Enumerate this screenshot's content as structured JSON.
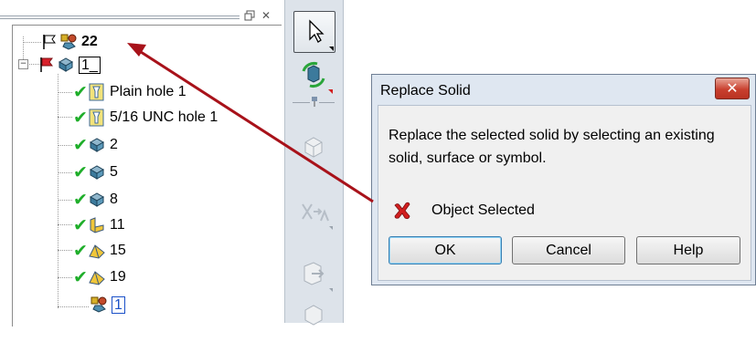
{
  "tree": {
    "items": [
      {
        "label": "22",
        "style": "bold"
      },
      {
        "label": "1_",
        "style": "boxed"
      },
      {
        "label": "Plain hole 1"
      },
      {
        "label": "5/16 UNC hole 1"
      },
      {
        "label": "2"
      },
      {
        "label": "5"
      },
      {
        "label": "8"
      },
      {
        "label": "11"
      },
      {
        "label": "15"
      },
      {
        "label": "19"
      },
      {
        "label": "1",
        "style": "boxed-blue"
      }
    ],
    "check_glyph": "✔",
    "expander_glyph": "−"
  },
  "panel": {
    "pin_glyph": "🗗",
    "close_glyph": "✕"
  },
  "toolbar": {
    "icons": [
      "select-pointer-icon",
      "rotate-solid-icon",
      "pin-icon",
      "box-icon",
      "split-icon",
      "export-icon",
      "cube-icon"
    ]
  },
  "dialog": {
    "title": "Replace Solid",
    "close_glyph": "✕",
    "message": "Replace the selected solid by selecting an existing solid, surface or symbol.",
    "status_text": "Object Selected",
    "buttons": {
      "ok": "OK",
      "cancel": "Cancel",
      "help": "Help"
    }
  },
  "colors": {
    "check": "#1fae2a",
    "arrow": "#a8121a",
    "status_icon": "#d21f1f",
    "dialog_bg": "#dfe7f1",
    "close_button": "#c9402f"
  }
}
